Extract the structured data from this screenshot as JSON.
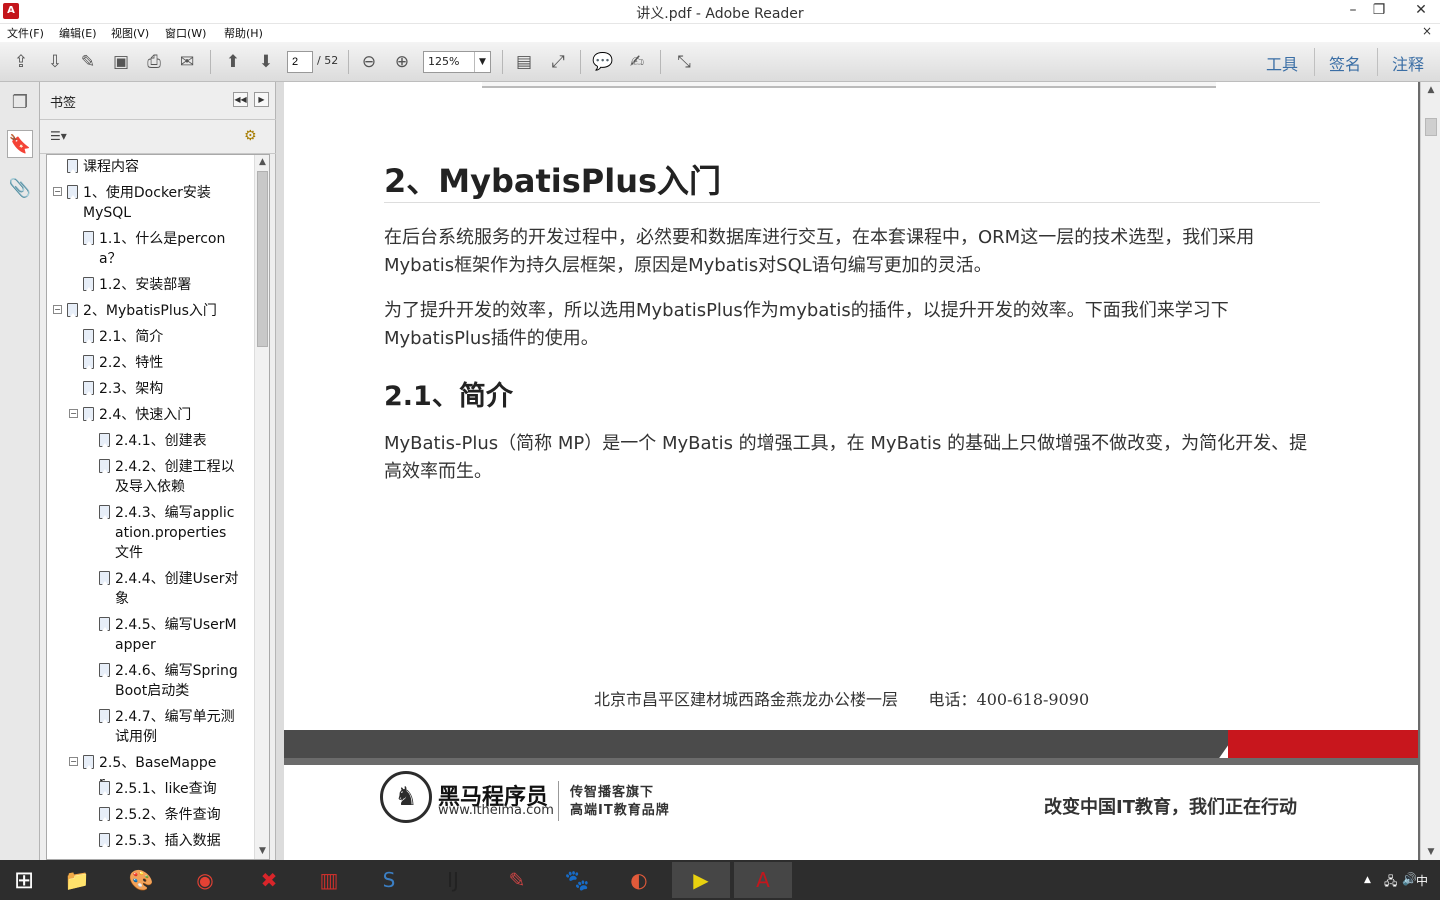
{
  "window": {
    "title": "讲义.pdf - Adobe Reader",
    "app_icon_text": "A",
    "minimize_symbol": "–",
    "restore_symbol": "❐",
    "close_symbol": "✕"
  },
  "menu": {
    "items": [
      "文件(F)",
      "编辑(E)",
      "视图(V)",
      "窗口(W)",
      "帮助(H)"
    ],
    "close_symbol": "×"
  },
  "toolbar": {
    "current_page": "2",
    "page_count": "/ 52",
    "zoom": "125%",
    "zoom_dropdown": "▼",
    "tools_label": "工具",
    "sign_label": "签名",
    "comment_label": "注释",
    "icons": [
      "create-pdf-icon",
      "export-pdf-icon",
      "edit-icon",
      "save-icon",
      "print-icon",
      "email-icon",
      "page-up-icon",
      "page-down-icon",
      "zoom-out-icon",
      "zoom-in-icon",
      "fit-page-icon",
      "fit-width-icon",
      "comment-icon",
      "highlight-icon",
      "fullscreen-icon"
    ],
    "glyphs": {
      "create": "⇪",
      "export": "⇩",
      "edit": "✎",
      "save": "▣",
      "print": "⎙",
      "email": "✉",
      "page_up": "⬆",
      "page_down": "⬇",
      "zoom_out": "⊖",
      "zoom_in": "⊕",
      "fit_page": "▤",
      "fit_width": "⤢",
      "comment": "💬",
      "highlight": "✍",
      "fullscreen": "⤡"
    }
  },
  "left_strip": {
    "glyphs": {
      "pages": "❐",
      "bookmarks": "🔖",
      "attachments": "📎"
    }
  },
  "bookmarks": {
    "title": "书签",
    "collapse_symbol": "◀◀",
    "close_symbol": "▶",
    "options_symbol": "☰▾",
    "options2_symbol": "⚙",
    "items": [
      {
        "label": "课程内容",
        "expander": ""
      },
      {
        "label": "1、使用Docker安装MySQL",
        "expander": "−"
      },
      {
        "label": "1.1、什么是percona？",
        "expander": ""
      },
      {
        "label": "1.2、安装部署",
        "expander": ""
      },
      {
        "label": "2、MybatisPlus入门",
        "expander": "−"
      },
      {
        "label": "2.1、简介",
        "expander": ""
      },
      {
        "label": "2.2、特性",
        "expander": ""
      },
      {
        "label": "2.3、架构",
        "expander": ""
      },
      {
        "label": "2.4、快速入门",
        "expander": "−"
      },
      {
        "label": "2.4.1、创建表",
        "expander": ""
      },
      {
        "label": "2.4.2、创建工程以及导入依赖",
        "expander": ""
      },
      {
        "label": "2.4.3、编写application.properties文件",
        "expander": ""
      },
      {
        "label": "2.4.4、创建User对象",
        "expander": ""
      },
      {
        "label": "2.4.5、编写UserMapper",
        "expander": ""
      },
      {
        "label": "2.4.6、编写SpringBoot启动类",
        "expander": ""
      },
      {
        "label": "2.4.7、编写单元测试用例",
        "expander": ""
      },
      {
        "label": "2.5、BaseMapper",
        "expander": "−"
      },
      {
        "label": "2.5.1、like查询",
        "expander": ""
      },
      {
        "label": "2.5.2、条件查询",
        "expander": ""
      },
      {
        "label": "2.5.3、插入数据",
        "expander": ""
      }
    ],
    "scroll_up": "▲",
    "scroll_down": "▼"
  },
  "document": {
    "h1": "2、MybatisPlus入门",
    "para1": "在后台系统服务的开发过程中，必然要和数据库进行交互，在本套课程中，ORM这一层的技术选型，我们采用Mybatis框架作为持久层框架，原因是Mybatis对SQL语句编写更加的灵活。",
    "para2": "为了提升开发的效率，所以选用MybatisPlus作为mybatis的插件，以提升开发的效率。下面我们来学习下MybatisPlus插件的使用。",
    "h2": "2.1、简介",
    "para3": "MyBatis-Plus（简称 MP）是一个 MyBatis 的增强工具，在 MyBatis 的基础上只做增强不做改变，为简化开发、提高效率而生。",
    "footer_address": "北京市昌平区建材城西路金燕龙办公楼一层",
    "footer_phone": "电话：400-618-9090",
    "logo_symbol": "♞",
    "logo_name": "黑马程序员",
    "logo_url": "www.itheima.com",
    "logo_tag1": "传智播客旗下",
    "logo_tag2": "高端IT教育品牌",
    "slogan": "改变中国IT教育，我们正在行动",
    "accent_red": "#c8161d"
  },
  "right_scroll": {
    "up": "▲",
    "down": "▼"
  },
  "taskbar": {
    "start_glyph": "⊞",
    "apps": [
      {
        "name": "file-explorer-icon",
        "glyph": "📁"
      },
      {
        "name": "paint-icon",
        "glyph": "🎨"
      },
      {
        "name": "chrome-icon",
        "glyph": "◉"
      },
      {
        "name": "xmind-icon",
        "glyph": "✖"
      },
      {
        "name": "winrar-icon",
        "glyph": "▥"
      },
      {
        "name": "sublime-icon",
        "glyph": "S"
      },
      {
        "name": "intellij-icon",
        "glyph": "IJ"
      },
      {
        "name": "notepad-icon",
        "glyph": "✎"
      },
      {
        "name": "pawprint-icon",
        "glyph": "🐾"
      },
      {
        "name": "swirl-app-icon",
        "glyph": "◐"
      },
      {
        "name": "media-player-icon",
        "glyph": "▶"
      },
      {
        "name": "acrobat-icon",
        "glyph": "A"
      }
    ],
    "tray_arrow": "▲",
    "tray_network": "🖧",
    "tray_volume": "🔊",
    "tray_ime": "中"
  }
}
